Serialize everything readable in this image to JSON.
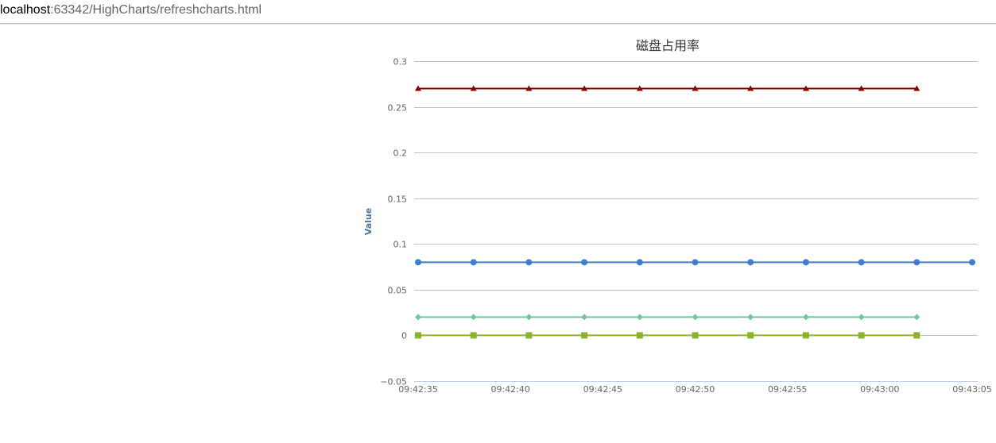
{
  "browser": {
    "url_host": "localhost",
    "url_rest": ":63342/HighCharts/refreshcharts.html"
  },
  "chart_data": {
    "type": "line",
    "title": "磁盘占用率",
    "xlabel": "",
    "ylabel": "Value",
    "x": [
      "09:42:35",
      "09:42:38",
      "09:42:41",
      "09:42:44",
      "09:42:47",
      "09:42:50",
      "09:42:53",
      "09:42:56",
      "09:42:59",
      "09:43:02",
      "09:43:05"
    ],
    "x_tick_labels": [
      "09:42:35",
      "09:42:40",
      "09:42:45",
      "09:42:50",
      "09:42:55",
      "09:43:00",
      "09:43:05"
    ],
    "ylim": [
      -0.05,
      0.3
    ],
    "y_ticks": [
      "−0.05",
      "0",
      "0.05",
      "0.1",
      "0.15",
      "0.2",
      "0.25",
      "0.3"
    ],
    "grid": true,
    "series": [
      {
        "color": "#8b0000",
        "marker": "triangle",
        "values": [
          0.27,
          0.27,
          0.27,
          0.27,
          0.27,
          0.27,
          0.27,
          0.27,
          0.27,
          0.27
        ]
      },
      {
        "color": "#3d7fcb",
        "marker": "circle",
        "values": [
          0.08,
          0.08,
          0.08,
          0.08,
          0.08,
          0.08,
          0.08,
          0.08,
          0.08,
          0.08,
          0.08
        ]
      },
      {
        "color": "#6ccb94",
        "marker": "diamond",
        "values": [
          0.02,
          0.02,
          0.02,
          0.02,
          0.02,
          0.02,
          0.02,
          0.02,
          0.02,
          0.02
        ]
      },
      {
        "color": "#8ab42c",
        "marker": "square",
        "values": [
          0,
          0,
          0,
          0,
          0,
          0,
          0,
          0,
          0,
          0
        ]
      }
    ]
  }
}
